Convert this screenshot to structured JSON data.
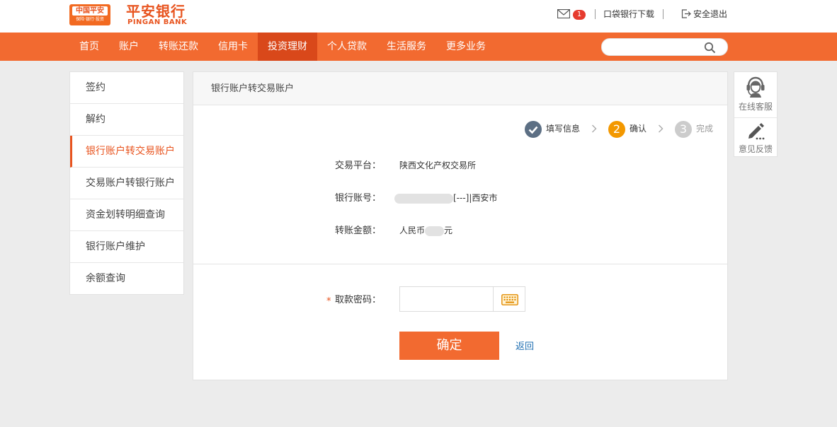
{
  "header": {
    "logo_line1": "中国平安",
    "logo_line2": "保险·银行·投资",
    "brand_cn": "平安银行",
    "brand_en": "PINGAN BANK",
    "mail_count": "1",
    "app_download": "口袋银行下载",
    "logout": "安全退出"
  },
  "nav": {
    "items": [
      "首页",
      "账户",
      "转账还款",
      "信用卡",
      "投资理财",
      "个人贷款",
      "生活服务",
      "更多业务"
    ],
    "active": "投资理财",
    "search_placeholder": ""
  },
  "sidebar": {
    "items": [
      "签约",
      "解约",
      "银行账户转交易账户",
      "交易账户转银行账户",
      "资金划转明细查询",
      "银行账户维护",
      "余额查询"
    ],
    "active": "银行账户转交易账户"
  },
  "panel": {
    "title": "银行账户转交易账户",
    "steps": [
      {
        "num": "✓",
        "label": "填写信息",
        "state": "done"
      },
      {
        "num": "2",
        "label": "确认",
        "state": "current"
      },
      {
        "num": "3",
        "label": "完成",
        "state": "pending"
      }
    ],
    "fields": {
      "platform_label": "交易平台：",
      "platform_value": "陕西文化产权交易所",
      "account_label": "银行账号：",
      "account_suffix": "[---]|西安市",
      "amount_label": "转账金额：",
      "amount_prefix": "人民币",
      "amount_suffix": "元"
    },
    "password": {
      "required_mark": "*",
      "label": "取款密码：",
      "value": ""
    },
    "confirm_label": "确定",
    "back_label": "返回"
  },
  "tools": {
    "service_label": "在线客服",
    "feedback_label": "意见反馈"
  },
  "colors": {
    "brand_orange": "#f26a30",
    "nav_active": "#d9481a",
    "step_done": "#5c6f84",
    "step_current": "#f39800",
    "step_pending": "#cccccc",
    "link_blue": "#1f6fb2"
  }
}
